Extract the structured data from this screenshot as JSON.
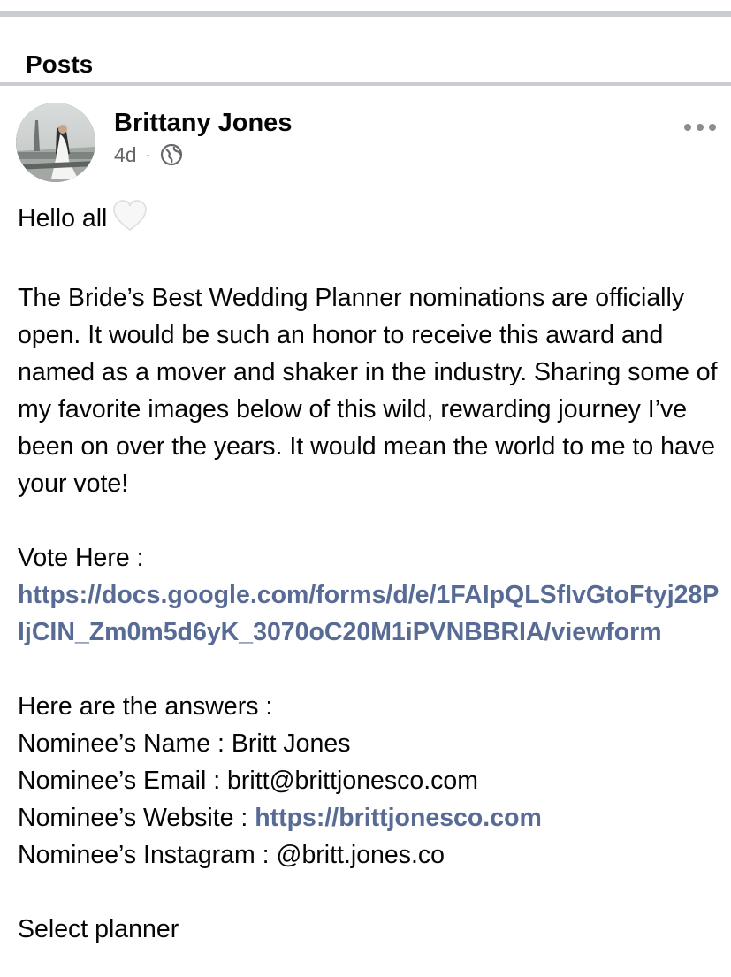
{
  "section": {
    "title": "Posts"
  },
  "post": {
    "author": "Brittany Jones",
    "time": "4d",
    "separator": "·",
    "privacy_icon": "globe-icon",
    "more_icon": "more-dots-icon",
    "greeting": "Hello all",
    "greeting_emoji": "white-heart-icon",
    "paragraph": "The Bride’s Best Wedding Planner nominations are officially open. It would be such an honor to receive this award and named as a mover and shaker in the industry. Sharing some of my favorite images below of this wild, rewarding journey I’ve been on over the years. It would mean the world to me to have your vote!",
    "vote_label": "Vote Here :",
    "vote_link": "https://docs.google.com/forms/d/e/1FAIpQLSfIvGtoFtyj28PljCIN_Zm0m5d6yK_3070oC20M1iPVNBBRIA/viewform",
    "answers_heading": "Here are the answers :",
    "name_label": "Nominee’s Name : Britt Jones",
    "email_label": "Nominee’s Email : britt@brittjonesco.com",
    "website_label": "Nominee’s Website : ",
    "website_link": "https://brittjonesco.com",
    "instagram_label": "Nominee’s Instagram : @britt.jones.co",
    "footer_text": "Select planner"
  },
  "colors": {
    "link": "#576b95",
    "divider": "#c9ccd1",
    "meta": "#65676b"
  }
}
